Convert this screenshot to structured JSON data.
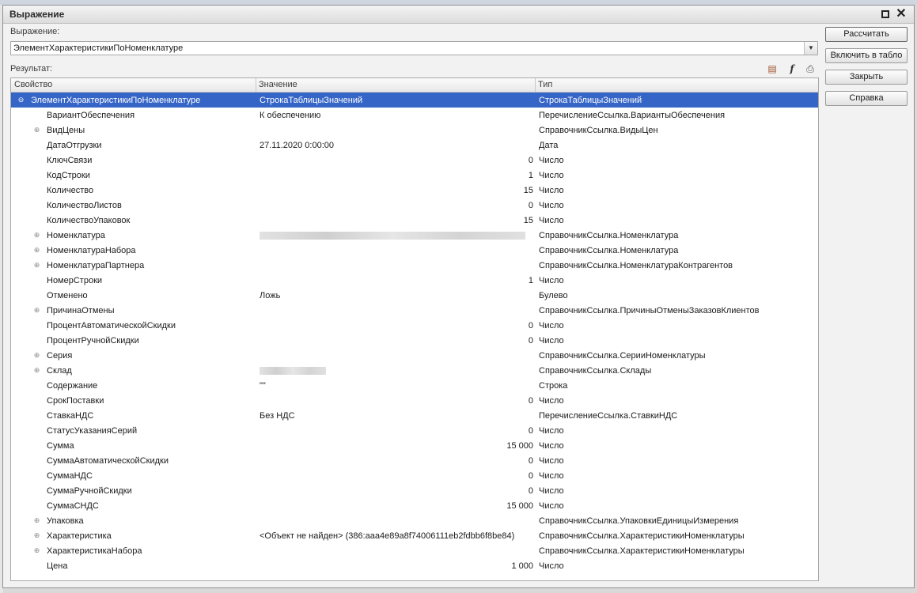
{
  "window": {
    "title": "Выражение"
  },
  "expression": {
    "label": "Выражение:",
    "value": "ЭлементХарактеристикиПоНоменклатуре"
  },
  "result": {
    "label": "Результат:"
  },
  "columns": {
    "property": "Свойство",
    "value": "Значение",
    "type": "Тип"
  },
  "buttons": {
    "calculate": "Рассчитать",
    "include": "Включить в табло",
    "close": "Закрыть",
    "help": "Справка"
  },
  "rows": [
    {
      "name": "ЭлементХарактеристикиПоНоменклатуре",
      "value": "СтрокаТаблицыЗначений",
      "type": "СтрокаТаблицыЗначений",
      "expander": "⊖",
      "root": true,
      "selected": true
    },
    {
      "name": "ВариантОбеспечения",
      "value": "К обеспечению",
      "type": "ПеречислениеСсылка.ВариантыОбеспечения"
    },
    {
      "name": "ВидЦены",
      "value": "",
      "type": "СправочникСсылка.ВидыЦен",
      "expander": "⊕"
    },
    {
      "name": "ДатаОтгрузки",
      "value": "27.11.2020 0:00:00",
      "type": "Дата"
    },
    {
      "name": "КлючСвязи",
      "value": "0",
      "type": "Число",
      "numeric": true
    },
    {
      "name": "КодСтроки",
      "value": "1",
      "type": "Число",
      "numeric": true
    },
    {
      "name": "Количество",
      "value": "15",
      "type": "Число",
      "numeric": true
    },
    {
      "name": "КоличествоЛистов",
      "value": "0",
      "type": "Число",
      "numeric": true
    },
    {
      "name": "КоличествоУпаковок",
      "value": "15",
      "type": "Число",
      "numeric": true
    },
    {
      "name": "Номенклатура",
      "value": "",
      "type": "СправочникСсылка.Номенклатура",
      "expander": "⊕",
      "redacted": "long"
    },
    {
      "name": "НоменклатураНабора",
      "value": "",
      "type": "СправочникСсылка.Номенклатура",
      "expander": "⊕"
    },
    {
      "name": "НоменклатураПартнера",
      "value": "",
      "type": "СправочникСсылка.НоменклатураКонтрагентов",
      "expander": "⊕"
    },
    {
      "name": "НомерСтроки",
      "value": "1",
      "type": "Число",
      "numeric": true
    },
    {
      "name": "Отменено",
      "value": "Ложь",
      "type": "Булево"
    },
    {
      "name": "ПричинаОтмены",
      "value": "",
      "type": "СправочникСсылка.ПричиныОтменыЗаказовКлиентов",
      "expander": "⊕"
    },
    {
      "name": "ПроцентАвтоматическойСкидки",
      "value": "0",
      "type": "Число",
      "numeric": true
    },
    {
      "name": "ПроцентРучнойСкидки",
      "value": "0",
      "type": "Число",
      "numeric": true
    },
    {
      "name": "Серия",
      "value": "",
      "type": "СправочникСсылка.СерииНоменклатуры",
      "expander": "⊕"
    },
    {
      "name": "Склад",
      "value": "",
      "type": "СправочникСсылка.Склады",
      "expander": "⊕",
      "redacted": "short"
    },
    {
      "name": "Содержание",
      "value": "\"\"",
      "type": "Строка"
    },
    {
      "name": "СрокПоставки",
      "value": "0",
      "type": "Число",
      "numeric": true
    },
    {
      "name": "СтавкаНДС",
      "value": "Без НДС",
      "type": "ПеречислениеСсылка.СтавкиНДС"
    },
    {
      "name": "СтатусУказанияСерий",
      "value": "0",
      "type": "Число",
      "numeric": true
    },
    {
      "name": "Сумма",
      "value": "15 000",
      "type": "Число",
      "numeric": true
    },
    {
      "name": "СуммаАвтоматическойСкидки",
      "value": "0",
      "type": "Число",
      "numeric": true
    },
    {
      "name": "СуммаНДС",
      "value": "0",
      "type": "Число",
      "numeric": true
    },
    {
      "name": "СуммаРучнойСкидки",
      "value": "0",
      "type": "Число",
      "numeric": true
    },
    {
      "name": "СуммаСНДС",
      "value": "15 000",
      "type": "Число",
      "numeric": true
    },
    {
      "name": "Упаковка",
      "value": "",
      "type": "СправочникСсылка.УпаковкиЕдиницыИзмерения",
      "expander": "⊕"
    },
    {
      "name": "Характеристика",
      "value": "<Объект не найден> (386:aaa4e89a8f74006111eb2fdbb6f8be84)",
      "type": "СправочникСсылка.ХарактеристикиНоменклатуры",
      "expander": "⊕"
    },
    {
      "name": "ХарактеристикаНабора",
      "value": "",
      "type": "СправочникСсылка.ХарактеристикиНоменклатуры",
      "expander": "⊕"
    },
    {
      "name": "Цена",
      "value": "1 000",
      "type": "Число",
      "numeric": true
    }
  ]
}
